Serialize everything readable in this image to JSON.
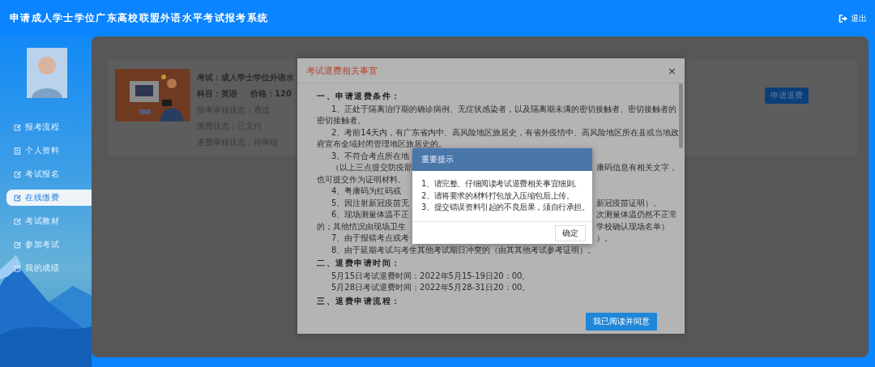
{
  "header": {
    "title": "申请成人学士学位广东高校联盟外语水平考试报考系统",
    "logout": "退出"
  },
  "sidebar": {
    "items": [
      {
        "label": "报考流程",
        "kind": "edit",
        "selected": false
      },
      {
        "label": "个人资料",
        "kind": "profile",
        "selected": false
      },
      {
        "label": "考试报名",
        "kind": "edit",
        "selected": false
      },
      {
        "label": "在线缴费",
        "kind": "edit",
        "selected": true
      },
      {
        "label": "考试教材",
        "kind": "edit",
        "selected": false
      },
      {
        "label": "参加考试",
        "kind": "edit",
        "selected": false
      },
      {
        "label": "我的成绩",
        "kind": "edit",
        "selected": false
      }
    ]
  },
  "exam_card": {
    "exam": "考试：成人学士学位外语水",
    "subject": "科目：英语",
    "price": "价格：120",
    "statuses": [
      "报考审核状态：通过",
      "缴费状态：已支付",
      "退费审核状态：待审核"
    ],
    "refund_button": "申请退费"
  },
  "refund_modal": {
    "title": "考试退费相关事宜",
    "close": "×",
    "lines": [
      {
        "kind": "heading",
        "text": "一、申请退费条件："
      },
      {
        "kind": "indented",
        "text": "1、正处于隔离治疗期的确诊病例、无症状感染者，以及隔离期未满的密切接触者、密切接触者的"
      },
      {
        "kind": "plain",
        "text": "密切接触者。"
      },
      {
        "kind": "indented",
        "text": "2、考前14天内，有广东省内中、高风险地区旅居史，有省外疫情中、高风险地区所在县或当地政"
      },
      {
        "kind": "plain",
        "text": "府宣布全域封闭管理地区旅居史的。"
      },
      {
        "kind": "indented",
        "text": "3、不符合考点所在地"
      },
      {
        "kind": "indented",
        "text": "（以上三点提交防疫部",
        "text_right": "康码信息有相关文字，"
      },
      {
        "kind": "plain",
        "text": "也可提交作为证明材料。"
      },
      {
        "kind": "indented",
        "text": "4、粤康码为红码或"
      },
      {
        "kind": "indented",
        "text": "5、因注射新冠疫苗无",
        "text_right": "新冠疫苗证明）。"
      },
      {
        "kind": "indented",
        "text": "6、现场测量体温不正",
        "text_right": "次测量体温仍然不正常"
      },
      {
        "kind": "plain",
        "text": "的；其他情况由现场卫生",
        "text_right": "学校确认现场名单）"
      },
      {
        "kind": "indented",
        "text": "7、由于报错考点或考",
        "text_right": "）。"
      },
      {
        "kind": "indented",
        "text": "8、由于延期考试与考生其他考试期日冲突的（由其其他考试参考证明）。"
      },
      {
        "kind": "heading",
        "text": "二、退费申请时间："
      },
      {
        "kind": "indented",
        "text": "5月15日考试退费时间：2022年5月15-19日20：00。"
      },
      {
        "kind": "indented",
        "text": "5月28日考试退费时间：2022年5月28-31日20：00。"
      },
      {
        "kind": "heading",
        "text": "三、退费申请流程："
      }
    ],
    "agree_button": "我已阅读并同意"
  },
  "notice_dialog": {
    "title": "重要提示",
    "lines": [
      "1、请完整、仔细阅读考试退费相关事宜细则。",
      "2、请将要求的材料打包放入压缩包后上传。",
      "3、提交错误资料引起的不良后果，须自行承担。"
    ],
    "confirm_button": "确定"
  }
}
